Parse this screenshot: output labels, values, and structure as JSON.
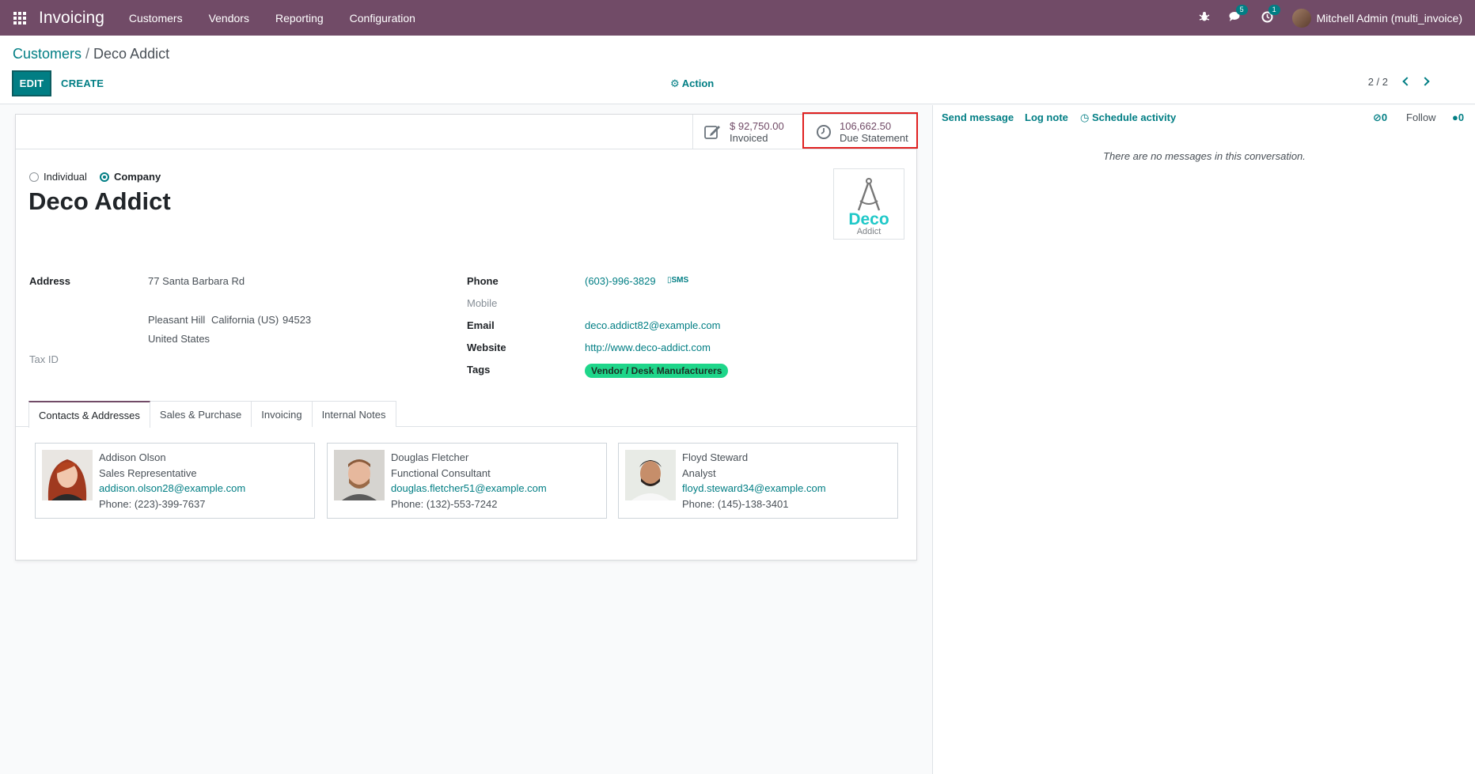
{
  "navbar": {
    "app_name": "Invoicing",
    "menus": [
      "Customers",
      "Vendors",
      "Reporting",
      "Configuration"
    ],
    "messages_badge": "5",
    "activities_badge": "1",
    "user": "Mitchell Admin (multi_invoice)",
    "icons": [
      "apps-icon",
      "bug-icon",
      "messages-icon",
      "activity-clock-icon"
    ]
  },
  "control_panel": {
    "breadcrumb_parent": "Customers",
    "breadcrumb_sep": "/",
    "breadcrumb_current": "Deco Addict",
    "edit_label": "EDIT",
    "create_label": "CREATE",
    "action_label": "Action",
    "pager": "2 / 2"
  },
  "stat_buttons": {
    "invoiced_value": "$ 92,750.00",
    "invoiced_label": "Invoiced",
    "due_value": "106,662.50",
    "due_label": "Due Statement"
  },
  "form": {
    "company_type_options": [
      "Individual",
      "Company"
    ],
    "company_type_selected": "Company",
    "name": "Deco Addict",
    "logo_word": "Deco",
    "logo_sub": "Addict",
    "address_label": "Address",
    "street": "77 Santa Barbara Rd",
    "city": "Pleasant Hill",
    "state": "California (US)",
    "zip": "94523",
    "country": "United States",
    "tax_id_label": "Tax ID",
    "phone_label": "Phone",
    "phone": "(603)-996-3829",
    "sms_label": "SMS",
    "mobile_label": "Mobile",
    "email_label": "Email",
    "email": "deco.addict82@example.com",
    "website_label": "Website",
    "website": "http://www.deco-addict.com",
    "tags_label": "Tags",
    "tag": "Vendor / Desk Manufacturers"
  },
  "tabs": [
    "Contacts & Addresses",
    "Sales & Purchase",
    "Invoicing",
    "Internal Notes"
  ],
  "contacts": [
    {
      "name": "Addison Olson",
      "function": "Sales Representative",
      "email": "addison.olson28@example.com",
      "phone": "Phone: (223)-399-7637"
    },
    {
      "name": "Douglas Fletcher",
      "function": "Functional Consultant",
      "email": "douglas.fletcher51@example.com",
      "phone": "Phone: (132)-553-7242"
    },
    {
      "name": "Floyd Steward",
      "function": "Analyst",
      "email": "floyd.steward34@example.com",
      "phone": "Phone: (145)-138-3401"
    }
  ],
  "chatter": {
    "send_message": "Send message",
    "log_note": "Log note",
    "schedule_activity": "Schedule activity",
    "attachments_count": "0",
    "follow": "Follow",
    "followers_count": "0",
    "empty_text": "There are no messages in this conversation."
  },
  "colors": {
    "brand": "#714b67",
    "primary": "#017e84",
    "tag": "#1ed68a",
    "highlight": "#e02020"
  }
}
